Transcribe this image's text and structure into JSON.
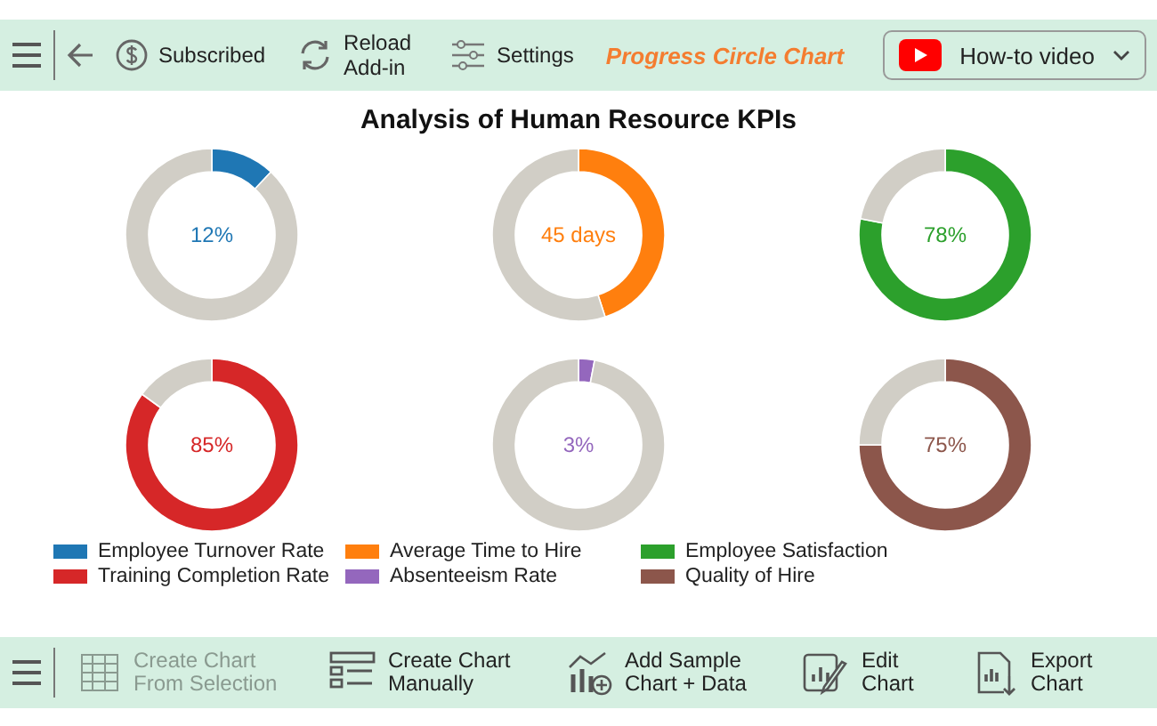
{
  "toolbar": {
    "buttons": [
      {
        "kind": "subscribed",
        "label": "Subscribed"
      },
      {
        "kind": "reload",
        "label": "Reload Add-in"
      },
      {
        "kind": "settings",
        "label": "Settings"
      }
    ],
    "title": "Progress Circle Chart",
    "video_button": "How-to video"
  },
  "chart": {
    "title": "Analysis of Human Resource KPIs",
    "donuts": [
      {
        "value": "12%",
        "color": "#1f77b4",
        "chart_data": {
          "type": "donut",
          "values": [
            12,
            88
          ]
        }
      },
      {
        "value": "45 days",
        "color": "#ff7f0e",
        "chart_data": {
          "type": "donut",
          "values": [
            45,
            55
          ]
        }
      },
      {
        "value": "78%",
        "color": "#2ca02c",
        "chart_data": {
          "type": "donut",
          "values": [
            78,
            22
          ]
        }
      },
      {
        "value": "85%",
        "color": "#d62728",
        "chart_data": {
          "type": "donut",
          "values": [
            85,
            15
          ]
        }
      },
      {
        "value": "3%",
        "color": "#9467bd",
        "chart_data": {
          "type": "donut",
          "values": [
            3,
            97
          ]
        }
      },
      {
        "value": "75%",
        "color": "#8c564b",
        "chart_data": {
          "type": "donut",
          "values": [
            75,
            25
          ]
        }
      }
    ],
    "legend": [
      {
        "label": "Employee Turnover Rate",
        "color": "#1f77b4"
      },
      {
        "label": "Average Time to Hire",
        "color": "#ff7f0e"
      },
      {
        "label": "Employee Satisfaction",
        "color": "#2ca02c"
      },
      {
        "label": "Training Completion Rate",
        "color": "#d62728"
      },
      {
        "label": "Absenteeism Rate",
        "color": "#9467bd"
      },
      {
        "label": "Quality of Hire",
        "color": "#8c564b"
      }
    ]
  },
  "bottom_bar": [
    {
      "kind": "selection",
      "label": "Create Chart From Selection",
      "disabled": true
    },
    {
      "kind": "manual",
      "label": "Create Chart Manually",
      "disabled": false
    },
    {
      "kind": "sample",
      "label": "Add Sample Chart + Data",
      "disabled": false
    },
    {
      "kind": "edit",
      "label": "Edit Chart",
      "disabled": false
    },
    {
      "kind": "export",
      "label": "Export Chart",
      "disabled": false
    }
  ]
}
